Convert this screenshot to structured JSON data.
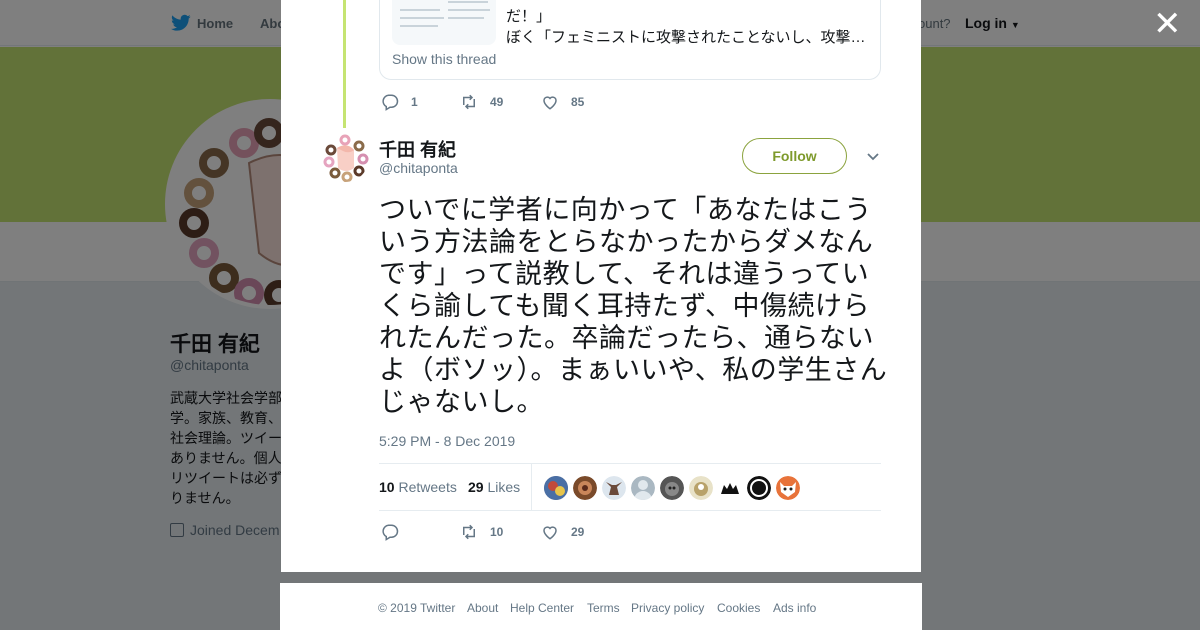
{
  "colors": {
    "accent": "#8ba33e",
    "banner": "#c5e472",
    "muted": "#657786",
    "twitter_blue": "#1da1f2"
  },
  "background": {
    "nav": {
      "home_label": "Home",
      "about_label": "Abo",
      "account_prompt": "ccount?",
      "login_label": "Log in"
    },
    "profile": {
      "name": "千田 有紀",
      "handle": "@chitaponta",
      "bio": "武蔵大学社会学部学。家族、教育、社会理論。ツイーありません。個人リツイートは必ずりません。",
      "joined": "Joined Decem"
    }
  },
  "modal": {
    "previous_tweet": {
      "quote_line1": "だ！」",
      "quote_line2": "ぼく「フェミニストに攻撃されたことないし、攻撃…",
      "show_thread": "Show this thread",
      "replies": "1",
      "retweets": "49",
      "likes": "85"
    },
    "tweet": {
      "name": "千田 有紀",
      "handle": "@chitaponta",
      "follow_label": "Follow",
      "text": "ついでに学者に向かって「あなたはこういう方法論をとらなかったからダメなんです」って説教して、それは違うっていくら諭しても聞く耳持たず、中傷続けられたんだった。卒論だったら、通らないよ（ボソッ）。まぁいいや、私の学生さんじゃないし。",
      "timestamp": "5:29 PM - 8 Dec 2019",
      "retweet_count": "10",
      "retweet_label": "Retweets",
      "like_count": "29",
      "like_label": "Likes",
      "actions": {
        "replies": "",
        "retweets": "10",
        "likes": "29"
      }
    }
  },
  "footer": {
    "links": [
      "© 2019 Twitter",
      "About",
      "Help Center",
      "Terms",
      "Privacy policy",
      "Cookies",
      "Ads info"
    ]
  },
  "icons": [
    "twitter-bird-icon",
    "close-icon",
    "reply-icon",
    "retweet-icon",
    "like-icon",
    "chevron-down-icon",
    "calendar-icon"
  ]
}
